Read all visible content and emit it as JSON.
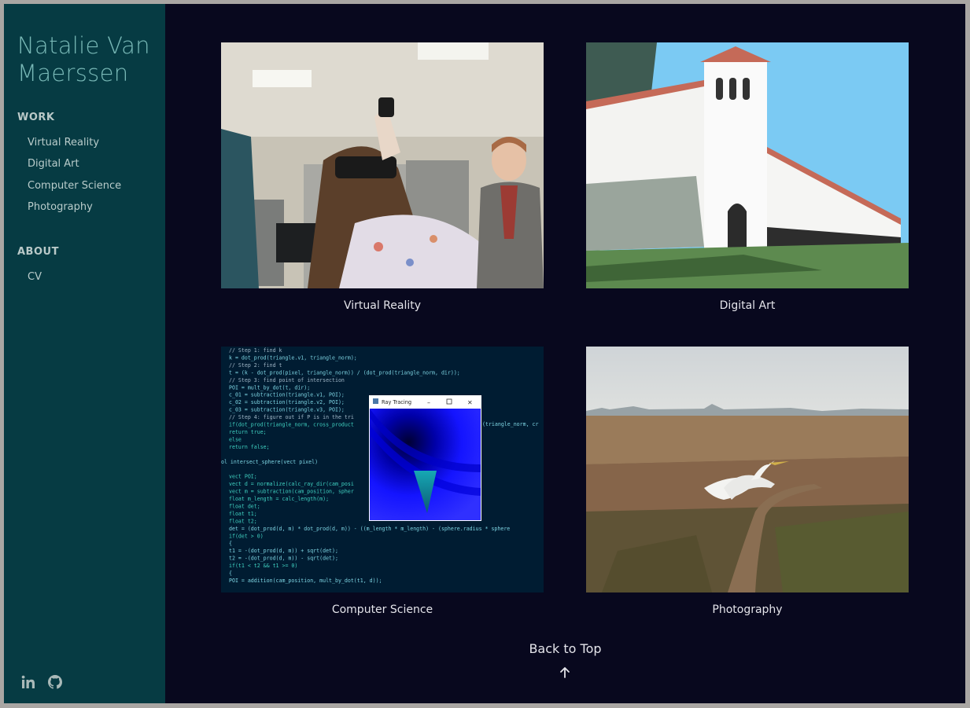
{
  "sidebar": {
    "title": "Natalie Van Maerssen",
    "work_heading": "WORK",
    "work_items": [
      "Virtual Reality",
      "Digital Art",
      "Computer Science",
      "Photography"
    ],
    "about_heading": "ABOUT",
    "about_items": [
      "CV"
    ],
    "social_icons": [
      "linkedin-icon",
      "github-icon"
    ]
  },
  "gallery": {
    "tiles": [
      {
        "caption": "Virtual Reality"
      },
      {
        "caption": "Digital Art"
      },
      {
        "caption": "Computer Science"
      },
      {
        "caption": "Photography"
      }
    ]
  },
  "code_screenshot": {
    "window_title": "Ray Tracing",
    "lines": [
      "// Step 1: find k",
      "k = dot_prod(triangle.v1, triangle_norm);",
      "// Step 2: find t",
      "t = (k - dot_prod(pixel, triangle_norm)) / (dot_prod(triangle_norm, dir));",
      "// Step 3: find point of intersection",
      "POI = mult_by_dot(t, dir);",
      "c_01 = subtraction(triangle.v1, POI);",
      "c_02 = subtraction(triangle.v2, POI);",
      "c_03 = subtraction(triangle.v3, POI);",
      "// Step 4: figure out if P is in the tri",
      "if(dot_prod(triangle_norm, cross_product",
      "    return true;",
      "else",
      "    return false;",
      "",
      "ol intersect_sphere(vect pixel)",
      "",
      "vect POI;",
      "vect d = normalize(calc_ray_dir(cam_posi",
      "vect m = subtraction(cam_position, spher",
      "float m_length = calc_length(m);",
      "float det;",
      "float t1;",
      "float t2;",
      "det = (dot_prod(d, m) * dot_prod(d, m)) - ((m_length * m_length) - (sphere.radius * sphere",
      "if(det > 0)",
      "{",
      "    t1 = -(dot_prod(d, m)) + sqrt(det);",
      "    t2 = -(dot_prod(d, m)) - sqrt(det);",
      "    if(t1 < t2 && t1 >= 0)",
      "    {",
      "        POI = addition(cam_position, mult_by_dot(t1, d));"
    ],
    "overflow_text": "(triangle_norm, cr"
  },
  "back_to_top": "Back to Top",
  "colors": {
    "sidebar_bg": "#063b43",
    "main_bg": "#08081e",
    "title": "#78b8b6",
    "nav_text": "#b9cccb"
  }
}
